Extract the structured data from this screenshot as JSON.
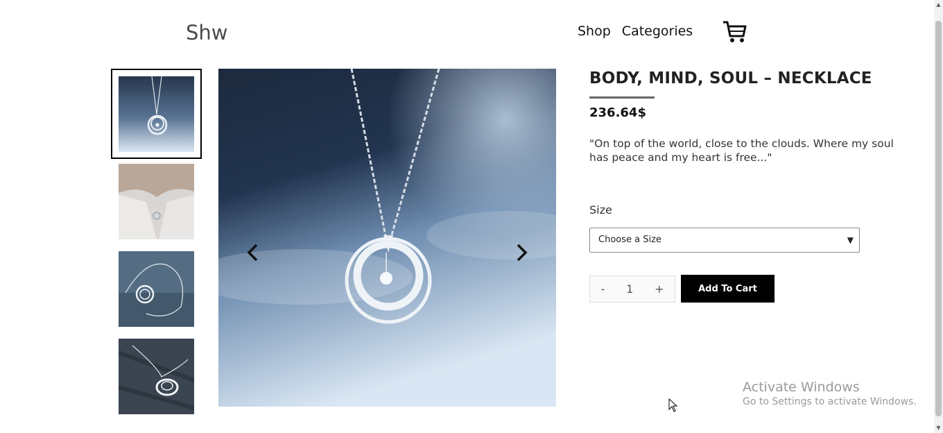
{
  "header": {
    "logo": "Shw",
    "nav": [
      "Shop",
      "Categories"
    ],
    "cart_icon": "shopping-cart-icon"
  },
  "gallery": {
    "thumbnails": [
      "necklace-closeup",
      "necklace-worn",
      "necklace-on-stone",
      "necklace-on-slate"
    ],
    "active_index": 0,
    "prev_icon": "chevron-left-icon",
    "next_icon": "chevron-right-icon"
  },
  "product": {
    "title": "BODY, MIND, SOUL – NECKLACE",
    "price": "236.64$",
    "description": "\"On top of the world, close to the clouds. Where my soul has peace and my heart is free...\"",
    "size_label": "Size",
    "size_select": "Choose a Size",
    "qty_minus": "-",
    "qty_value": "1",
    "qty_plus": "+",
    "add_to_cart": "Add To Cart"
  },
  "watermark": {
    "line1": "Activate Windows",
    "line2": "Go to Settings to activate Windows."
  }
}
